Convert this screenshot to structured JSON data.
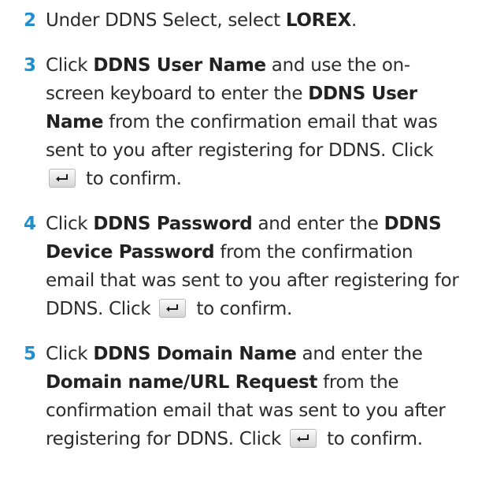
{
  "accent_color": "#1f8fcd",
  "icons": {
    "enter_key": "enter-key-icon"
  },
  "steps": [
    {
      "number": "2",
      "parts": [
        {
          "t": "Under DDNS Select, select "
        },
        {
          "t": "LOREX",
          "b": true
        },
        {
          "t": "."
        }
      ]
    },
    {
      "number": "3",
      "parts": [
        {
          "t": "Click "
        },
        {
          "t": "DDNS User Name",
          "b": true
        },
        {
          "t": " and use the on-screen keyboard to enter the "
        },
        {
          "t": "DDNS User Name",
          "b": true
        },
        {
          "t": " from the confirmation email that was sent to you after registering for DDNS. Click "
        },
        {
          "icon": "enter-key-icon"
        },
        {
          "t": " to confirm."
        }
      ]
    },
    {
      "number": "4",
      "parts": [
        {
          "t": "Click "
        },
        {
          "t": "DDNS Password",
          "b": true
        },
        {
          "t": " and enter the "
        },
        {
          "t": "DDNS Device Password",
          "b": true
        },
        {
          "t": " from the confirmation email that was sent to you after registering for DDNS. Click "
        },
        {
          "icon": "enter-key-icon"
        },
        {
          "t": " to confirm."
        }
      ]
    },
    {
      "number": "5",
      "parts": [
        {
          "t": "Click "
        },
        {
          "t": "DDNS Domain Name",
          "b": true
        },
        {
          "t": " and enter the "
        },
        {
          "t": "Domain name/URL Request",
          "b": true
        },
        {
          "t": " from the confirmation email that was sent to you after registering for DDNS. Click "
        },
        {
          "icon": "enter-key-icon"
        },
        {
          "t": " to confirm."
        }
      ]
    }
  ]
}
